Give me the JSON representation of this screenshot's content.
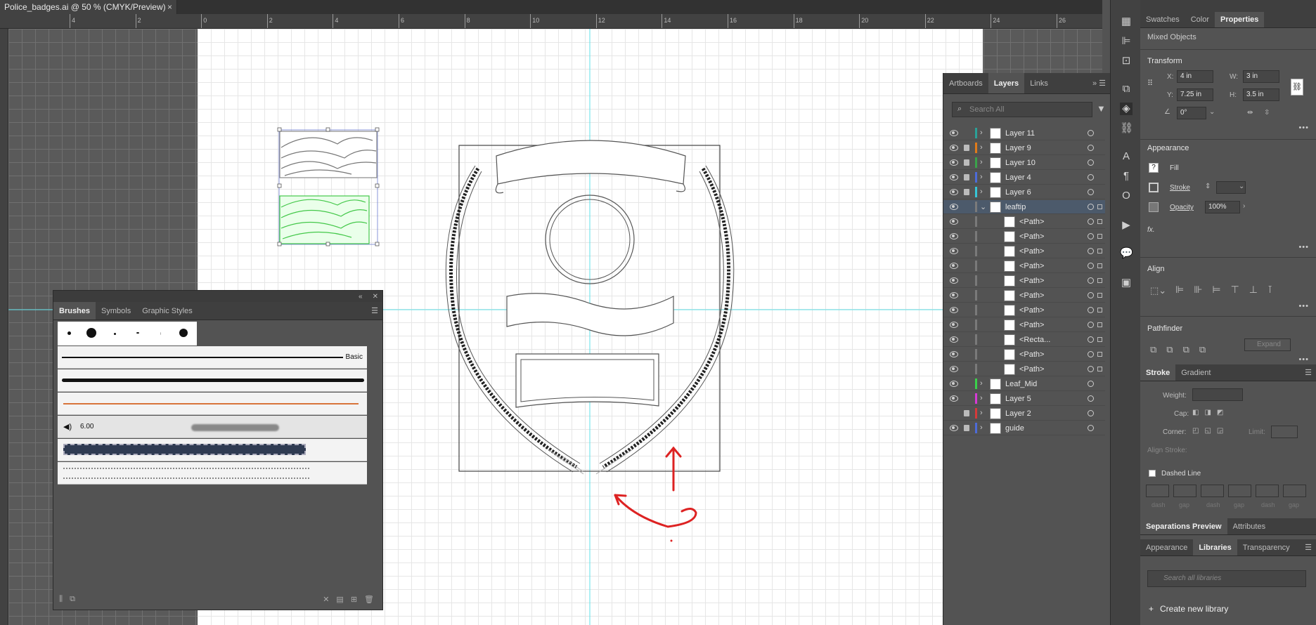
{
  "document_tab": {
    "title": "Police_badges.ai @ 50 % (CMYK/Preview)",
    "close": "×"
  },
  "ruler": {
    "h_ticks": [
      "4",
      "2",
      "0",
      "2",
      "4",
      "6",
      "8",
      "10",
      "12",
      "14",
      "16",
      "18",
      "20",
      "22",
      "24",
      "26"
    ]
  },
  "brushes_panel": {
    "tabs": [
      "Brushes",
      "Symbols",
      "Graphic Styles"
    ],
    "basic_label": "Basic",
    "size_value": "6.00"
  },
  "layers_panel": {
    "tabs": [
      "Artboards",
      "Layers",
      "Links"
    ],
    "search_placeholder": "Search All",
    "layers": [
      {
        "name": "Layer 11",
        "color": "#2aa198",
        "locked": false,
        "expanded": false
      },
      {
        "name": "Layer 9",
        "color": "#e07b1a",
        "locked": true,
        "expanded": false
      },
      {
        "name": "Layer 10",
        "color": "#3aa34a",
        "locked": true,
        "expanded": false
      },
      {
        "name": "Layer 4",
        "color": "#4d6bd8",
        "locked": true,
        "expanded": false
      },
      {
        "name": "Layer 6",
        "color": "#37c6d6",
        "locked": true,
        "expanded": false
      },
      {
        "name": "leaftip",
        "color": "#7a7a7a",
        "locked": false,
        "expanded": true,
        "selected": true
      },
      {
        "name": "<Path>",
        "sub": true
      },
      {
        "name": "<Path>",
        "sub": true
      },
      {
        "name": "<Path>",
        "sub": true
      },
      {
        "name": "<Path>",
        "sub": true
      },
      {
        "name": "<Path>",
        "sub": true
      },
      {
        "name": "<Path>",
        "sub": true
      },
      {
        "name": "<Path>",
        "sub": true
      },
      {
        "name": "<Path>",
        "sub": true
      },
      {
        "name": "<Recta...",
        "sub": true
      },
      {
        "name": "<Path>",
        "sub": true
      },
      {
        "name": "<Path>",
        "sub": true
      },
      {
        "name": "Leaf_Mid",
        "color": "#3ad24a",
        "locked": false,
        "expanded": false
      },
      {
        "name": "Layer 5",
        "color": "#d63ad6",
        "locked": false,
        "expanded": false
      },
      {
        "name": "Layer 2",
        "color": "#d63a3a",
        "locked": true,
        "expanded": false,
        "hidden": true
      },
      {
        "name": "guide",
        "color": "#4d6bd8",
        "locked": true,
        "expanded": false
      }
    ]
  },
  "properties": {
    "tabs": [
      "Swatches",
      "Color",
      "Properties"
    ],
    "selection": "Mixed Objects",
    "transform": {
      "title": "Transform",
      "x_label": "X:",
      "x": "4 in",
      "y_label": "Y:",
      "y": "7.25 in",
      "w_label": "W:",
      "w": "3 in",
      "h_label": "H:",
      "h": "3.5 in",
      "angle": "0°"
    },
    "appearance": {
      "title": "Appearance",
      "fill": "Fill",
      "stroke": "Stroke",
      "opacity": "Opacity",
      "opacity_value": "100%",
      "fx": "fx."
    },
    "align": {
      "title": "Align"
    },
    "pathfinder": {
      "title": "Pathfinder",
      "expand": "Expand"
    },
    "stroke_panel": {
      "tabs": [
        "Stroke",
        "Gradient"
      ],
      "weight": "Weight:",
      "cap": "Cap:",
      "corner": "Corner:",
      "limit": "Limit:",
      "align_stroke": "Align Stroke:",
      "dashed": "Dashed Line",
      "dash_labels": [
        "dash",
        "gap",
        "dash",
        "gap",
        "dash",
        "gap"
      ]
    },
    "separations": {
      "tabs": [
        "Separations Preview",
        "Attributes"
      ]
    },
    "libraries": {
      "tabs": [
        "Appearance",
        "Libraries",
        "Transparency"
      ],
      "search_placeholder": "Search all libraries",
      "create": "Create new library"
    }
  }
}
